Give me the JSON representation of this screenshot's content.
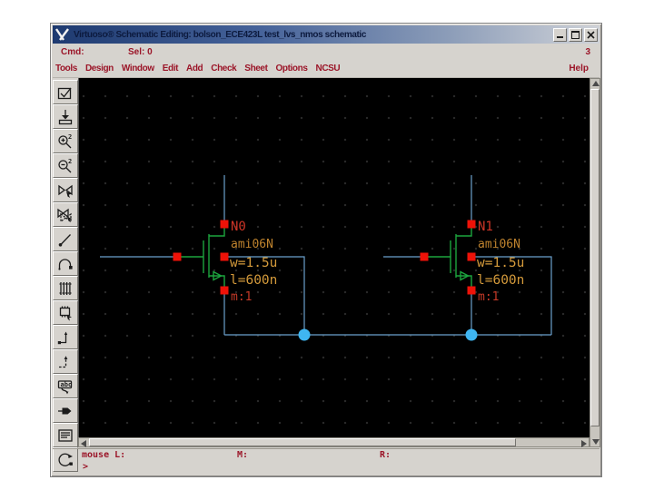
{
  "window": {
    "title": "Virtuoso® Schematic Editing: bolson_ECE423L test_lvs_nmos schematic",
    "window_number": "3"
  },
  "command_bar": {
    "cmd_label": "Cmd:",
    "sel_label": "Sel: 0"
  },
  "menu": {
    "items": [
      "Tools",
      "Design",
      "Window",
      "Edit",
      "Add",
      "Check",
      "Sheet",
      "Options",
      "NCSU"
    ],
    "help": "Help"
  },
  "toolbar": {
    "zoom_factor": "2",
    "label_icon_text": "abc",
    "icons": [
      "check-save",
      "save",
      "zoom-in-2x",
      "zoom-out-2x",
      "stretch",
      "copy",
      "delete",
      "undo",
      "property",
      "instance",
      "wire-narrow",
      "wire-wide",
      "wire-label",
      "pin",
      "sheet",
      "redraw"
    ]
  },
  "schematic": {
    "transistors": [
      {
        "name": "N0",
        "model": "ami06N",
        "width": "w=1.5u",
        "length": "l=600n",
        "multiplier": "m:1"
      },
      {
        "name": "N1",
        "model": "ami06N",
        "width": "w=1.5u",
        "length": "l=600n",
        "multiplier": "m:1"
      }
    ],
    "colors": {
      "wire": "#6aa0cc",
      "device": "#1ca53e",
      "pin": "#ee1208",
      "junction": "#3fb6f2",
      "instance_label": "#cf3527",
      "param_label": "#d49a3b",
      "model_label": "#bf832e"
    }
  },
  "status_bar": {
    "mouse_left": "mouse L:",
    "mouse_middle": "M:",
    "mouse_right": "R:",
    "prompt": ">"
  },
  "chrome_colors": {
    "background": "#d6d3ce",
    "text": "#9b1528",
    "titlebar_start": "#1e3a70",
    "titlebar_end": "#cfd2d8"
  }
}
